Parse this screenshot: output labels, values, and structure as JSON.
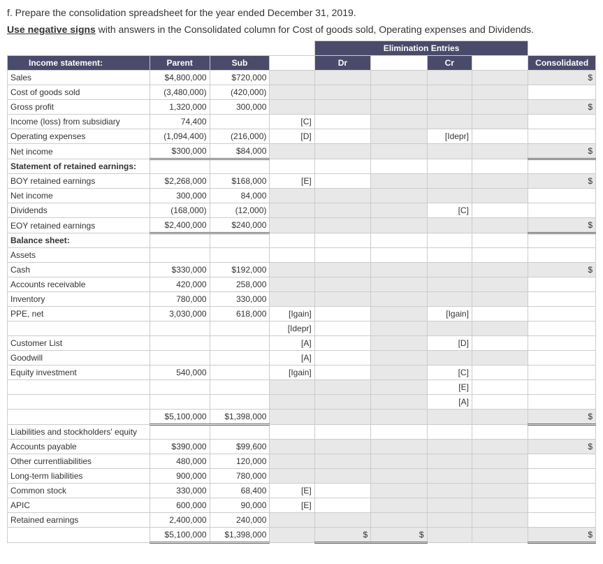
{
  "intro": {
    "line1": "f. Prepare the consolidation spreadsheet for the year ended December 31, 2019.",
    "line2a": "Use negative signs",
    "line2b": " with answers in the Consolidated column for Cost of goods sold, Operating expenses and Dividends."
  },
  "headers": {
    "elim": "Elimination Entries",
    "income": "Income statement:",
    "parent": "Parent",
    "sub": "Sub",
    "dr": "Dr",
    "cr": "Cr",
    "cons": "Consolidated"
  },
  "rows": {
    "sales": {
      "l": "Sales",
      "p": "$4,800,000",
      "s": "$720,000",
      "cons": "$"
    },
    "cogs": {
      "l": "Cost of goods sold",
      "p": "(3,480,000)",
      "s": "(420,000)"
    },
    "gross": {
      "l": "Gross profit",
      "p": "1,320,000",
      "s": "300,000",
      "cons": "$"
    },
    "incsub": {
      "l": "Income (loss) from subsidiary",
      "p": "74,400",
      "drb": "[C]"
    },
    "opex": {
      "l": "Operating expenses",
      "p": "(1,094,400)",
      "s": "(216,000)",
      "drb": "[D]",
      "crb": "[Idepr]"
    },
    "netinc": {
      "l": "Net income",
      "p": "$300,000",
      "s": "$84,000",
      "cons": "$"
    },
    "sre": {
      "l": "Statement of retained earnings:"
    },
    "boyre": {
      "l": "BOY retained earnings",
      "p": "$2,268,000",
      "s": "$168,000",
      "drb": "[E]",
      "cons": "$"
    },
    "netinc2": {
      "l": "Net income",
      "p": "300,000",
      "s": "84,000"
    },
    "div": {
      "l": "Dividends",
      "p": "(168,000)",
      "s": "(12,000)",
      "crb": "[C]"
    },
    "eoyre": {
      "l": "EOY retained earnings",
      "p": "$2,400,000",
      "s": "$240,000",
      "cons": "$"
    },
    "bs": {
      "l": "Balance sheet:"
    },
    "assets": {
      "l": "Assets"
    },
    "cash": {
      "l": "Cash",
      "p": "$330,000",
      "s": "$192,000",
      "cons": "$"
    },
    "ar": {
      "l": "Accounts receivable",
      "p": "420,000",
      "s": "258,000"
    },
    "inv": {
      "l": "Inventory",
      "p": "780,000",
      "s": "330,000"
    },
    "ppe": {
      "l": "PPE, net",
      "p": "3,030,000",
      "s": "618,000",
      "drb": "[Igain]",
      "crb": "[Igain]"
    },
    "ppe2": {
      "drb": "[Idepr]"
    },
    "cust": {
      "l": "Customer List",
      "drb": "[A]",
      "crb": "[D]"
    },
    "gw": {
      "l": "Goodwill",
      "drb": "[A]"
    },
    "eqinv": {
      "l": "Equity investment",
      "p": "540,000",
      "drb": "[Igain]",
      "crb": "[C]"
    },
    "eqinv2": {
      "crb": "[E]"
    },
    "eqinv3": {
      "crb": "[A]"
    },
    "tot1": {
      "p": "$5,100,000",
      "s": "$1,398,000",
      "cons": "$"
    },
    "liab": {
      "l": "Liabilities and stockholders' equity"
    },
    "ap": {
      "l": "Accounts payable",
      "p": "$390,000",
      "s": "$99,600",
      "cons": "$"
    },
    "ocl": {
      "l": "Other currentliabilities",
      "p": "480,000",
      "s": "120,000"
    },
    "ltl": {
      "l": "Long-term liabilities",
      "p": "900,000",
      "s": "780,000"
    },
    "cs": {
      "l": "Common stock",
      "p": "330,000",
      "s": "68,400",
      "drb": "[E]"
    },
    "apic": {
      "l": "APIC",
      "p": "600,000",
      "s": "90,000",
      "drb": "[E]"
    },
    "re": {
      "l": "Retained earnings",
      "p": "2,400,000",
      "s": "240,000"
    },
    "tot2": {
      "p": "$5,100,000",
      "s": "$1,398,000",
      "dr": "$",
      "cr": "$",
      "cons": "$"
    }
  }
}
